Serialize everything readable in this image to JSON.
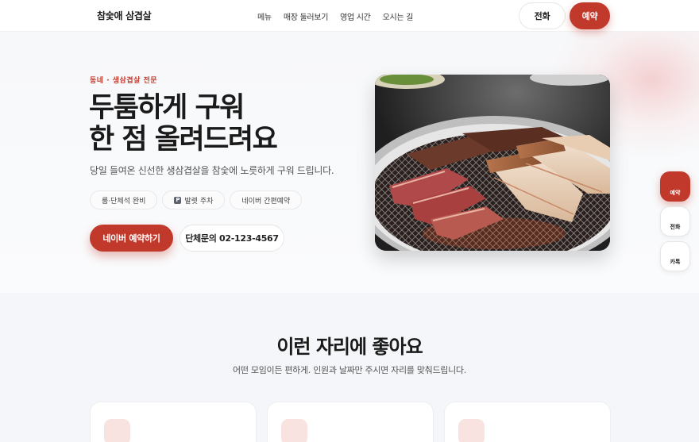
{
  "header": {
    "brand": "참숯애 삼겹살",
    "nav": [
      "메뉴",
      "매장 둘러보기",
      "영업 시간",
      "오시는 길"
    ],
    "call_label": "전화",
    "book_label": "예약"
  },
  "hero": {
    "eyebrow": "동네 · 생삼겹살 전문",
    "title_line1": "두툼하게 구워",
    "title_line2": "한 점 올려드려요",
    "description": "당일 들여온 신선한 생삼겹살을 참숯에 노릇하게 구워 드립니다.",
    "chips": [
      "룸·단체석 완비",
      "발렛 주차",
      "네이버 간편예약"
    ],
    "parking_icon_letter": "P",
    "cta_book": "네이버 예약하기",
    "cta_call": "단체문의 02-123-4567"
  },
  "floating": {
    "book": "예약",
    "call": "전화",
    "kakao": "카톡"
  },
  "section": {
    "title": "이런 자리에 좋아요",
    "subtitle": "어떤 모임이든 편하게. 인원과 날짜만 주시면 자리를 맞춰드립니다."
  },
  "colors": {
    "accent": "#c0392b",
    "chip_border": "#e6e8ec",
    "section_bg": "#f5f6f9",
    "card_icon_bg": "#f8e3e0"
  },
  "icons": {
    "parking": "parking-icon",
    "hero_image": "grilled-pork-belly-photo"
  }
}
